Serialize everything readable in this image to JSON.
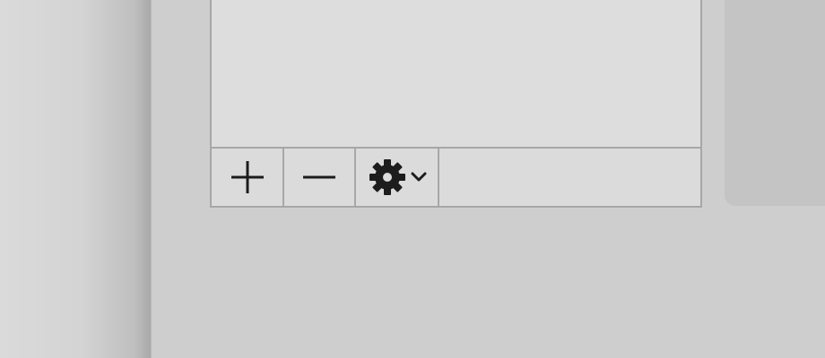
{
  "toolbar": {
    "buttons": [
      {
        "id": "add",
        "icon": "plus-icon"
      },
      {
        "id": "remove",
        "icon": "minus-icon"
      },
      {
        "id": "actions",
        "icon": "gear-icon",
        "secondary_icon": "chevron-down-icon"
      }
    ]
  },
  "colors": {
    "pane_background": "#dddddd",
    "border": "#a7a7a7",
    "window_background": "#cecece",
    "icon": "#1c1c1c"
  }
}
